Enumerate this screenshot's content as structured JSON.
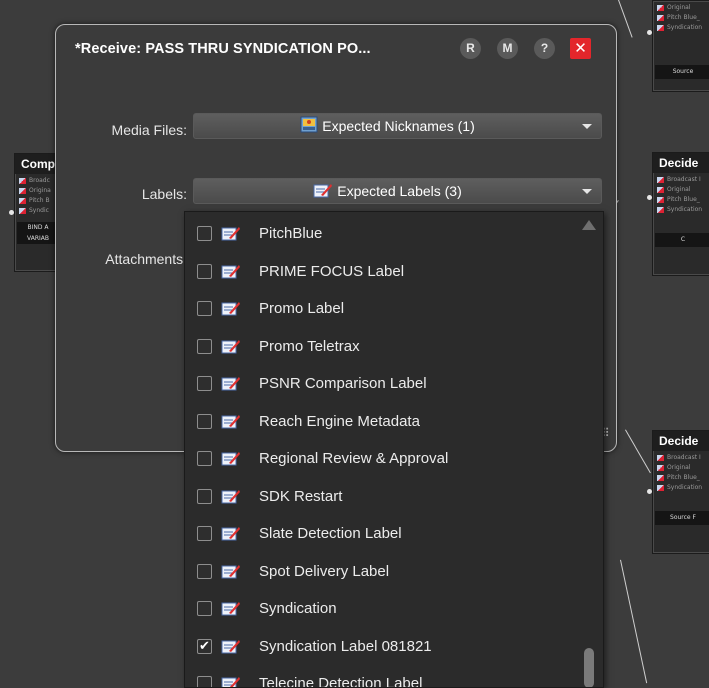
{
  "dialog": {
    "title": "*Receive: PASS THRU SYNDICATION PO...",
    "buttons": {
      "r": "R",
      "m": "M",
      "help": "?",
      "close": "✕"
    },
    "media_files": {
      "label": "Media Files:",
      "value": "Expected Nicknames (1)"
    },
    "labels": {
      "label": "Labels:",
      "value": "Expected Labels (3)"
    },
    "attachments": {
      "label": "Attachments:"
    }
  },
  "label_list": {
    "items": [
      {
        "label": "PitchBlue",
        "checked": false
      },
      {
        "label": "PRIME FOCUS Label",
        "checked": false
      },
      {
        "label": "Promo Label",
        "checked": false
      },
      {
        "label": "Promo Teletrax",
        "checked": false
      },
      {
        "label": "PSNR Comparison Label",
        "checked": false
      },
      {
        "label": "Reach Engine Metadata",
        "checked": false
      },
      {
        "label": "Regional Review & Approval",
        "checked": false
      },
      {
        "label": "SDK Restart",
        "checked": false
      },
      {
        "label": "Slate Detection Label",
        "checked": false
      },
      {
        "label": "Spot Delivery Label",
        "checked": false
      },
      {
        "label": "Syndication",
        "checked": false
      },
      {
        "label": "Syndication Label  081821",
        "checked": true
      },
      {
        "label": "Telecine Detection Label",
        "checked": false
      }
    ],
    "checkmark": "✔"
  },
  "background_nodes": {
    "left_node": {
      "title": "Comp",
      "rows": [
        "Broadc",
        "Origina",
        "Pitch B",
        "Syndic"
      ],
      "footer": "BIND A VARIAB"
    },
    "top_right_node": {
      "title": "",
      "rows": [
        "Original",
        "Pitch Blue_",
        "Syndication"
      ],
      "footer": "Source"
    },
    "mid_right_node": {
      "title": "Decide",
      "rows": [
        "Broadcast I",
        "Original",
        "Pitch Blue_",
        "Syndication"
      ],
      "footer": "C"
    },
    "low_right_node": {
      "title": "Decide",
      "rows": [
        "Broadcast I",
        "Original",
        "Pitch Blue_",
        "Syndication"
      ],
      "footer": "Source F"
    }
  },
  "icons": {
    "media": "media-file-icon",
    "label": "label-icon",
    "grip": "resize-grip-icon"
  }
}
